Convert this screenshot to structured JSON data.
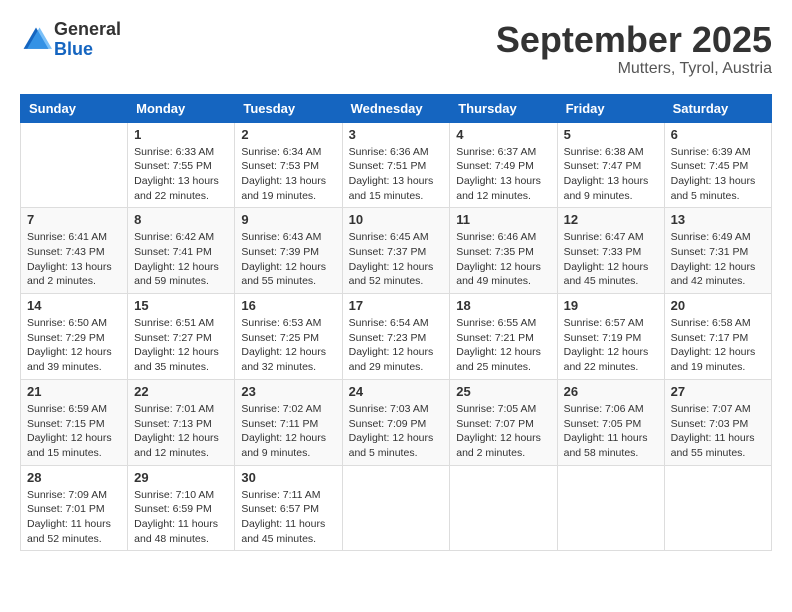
{
  "header": {
    "logo_general": "General",
    "logo_blue": "Blue",
    "month_title": "September 2025",
    "location": "Mutters, Tyrol, Austria"
  },
  "weekdays": [
    "Sunday",
    "Monday",
    "Tuesday",
    "Wednesday",
    "Thursday",
    "Friday",
    "Saturday"
  ],
  "weeks": [
    [
      {
        "day": "",
        "info": ""
      },
      {
        "day": "1",
        "info": "Sunrise: 6:33 AM\nSunset: 7:55 PM\nDaylight: 13 hours and 22 minutes."
      },
      {
        "day": "2",
        "info": "Sunrise: 6:34 AM\nSunset: 7:53 PM\nDaylight: 13 hours and 19 minutes."
      },
      {
        "day": "3",
        "info": "Sunrise: 6:36 AM\nSunset: 7:51 PM\nDaylight: 13 hours and 15 minutes."
      },
      {
        "day": "4",
        "info": "Sunrise: 6:37 AM\nSunset: 7:49 PM\nDaylight: 13 hours and 12 minutes."
      },
      {
        "day": "5",
        "info": "Sunrise: 6:38 AM\nSunset: 7:47 PM\nDaylight: 13 hours and 9 minutes."
      },
      {
        "day": "6",
        "info": "Sunrise: 6:39 AM\nSunset: 7:45 PM\nDaylight: 13 hours and 5 minutes."
      }
    ],
    [
      {
        "day": "7",
        "info": "Sunrise: 6:41 AM\nSunset: 7:43 PM\nDaylight: 13 hours and 2 minutes."
      },
      {
        "day": "8",
        "info": "Sunrise: 6:42 AM\nSunset: 7:41 PM\nDaylight: 12 hours and 59 minutes."
      },
      {
        "day": "9",
        "info": "Sunrise: 6:43 AM\nSunset: 7:39 PM\nDaylight: 12 hours and 55 minutes."
      },
      {
        "day": "10",
        "info": "Sunrise: 6:45 AM\nSunset: 7:37 PM\nDaylight: 12 hours and 52 minutes."
      },
      {
        "day": "11",
        "info": "Sunrise: 6:46 AM\nSunset: 7:35 PM\nDaylight: 12 hours and 49 minutes."
      },
      {
        "day": "12",
        "info": "Sunrise: 6:47 AM\nSunset: 7:33 PM\nDaylight: 12 hours and 45 minutes."
      },
      {
        "day": "13",
        "info": "Sunrise: 6:49 AM\nSunset: 7:31 PM\nDaylight: 12 hours and 42 minutes."
      }
    ],
    [
      {
        "day": "14",
        "info": "Sunrise: 6:50 AM\nSunset: 7:29 PM\nDaylight: 12 hours and 39 minutes."
      },
      {
        "day": "15",
        "info": "Sunrise: 6:51 AM\nSunset: 7:27 PM\nDaylight: 12 hours and 35 minutes."
      },
      {
        "day": "16",
        "info": "Sunrise: 6:53 AM\nSunset: 7:25 PM\nDaylight: 12 hours and 32 minutes."
      },
      {
        "day": "17",
        "info": "Sunrise: 6:54 AM\nSunset: 7:23 PM\nDaylight: 12 hours and 29 minutes."
      },
      {
        "day": "18",
        "info": "Sunrise: 6:55 AM\nSunset: 7:21 PM\nDaylight: 12 hours and 25 minutes."
      },
      {
        "day": "19",
        "info": "Sunrise: 6:57 AM\nSunset: 7:19 PM\nDaylight: 12 hours and 22 minutes."
      },
      {
        "day": "20",
        "info": "Sunrise: 6:58 AM\nSunset: 7:17 PM\nDaylight: 12 hours and 19 minutes."
      }
    ],
    [
      {
        "day": "21",
        "info": "Sunrise: 6:59 AM\nSunset: 7:15 PM\nDaylight: 12 hours and 15 minutes."
      },
      {
        "day": "22",
        "info": "Sunrise: 7:01 AM\nSunset: 7:13 PM\nDaylight: 12 hours and 12 minutes."
      },
      {
        "day": "23",
        "info": "Sunrise: 7:02 AM\nSunset: 7:11 PM\nDaylight: 12 hours and 9 minutes."
      },
      {
        "day": "24",
        "info": "Sunrise: 7:03 AM\nSunset: 7:09 PM\nDaylight: 12 hours and 5 minutes."
      },
      {
        "day": "25",
        "info": "Sunrise: 7:05 AM\nSunset: 7:07 PM\nDaylight: 12 hours and 2 minutes."
      },
      {
        "day": "26",
        "info": "Sunrise: 7:06 AM\nSunset: 7:05 PM\nDaylight: 11 hours and 58 minutes."
      },
      {
        "day": "27",
        "info": "Sunrise: 7:07 AM\nSunset: 7:03 PM\nDaylight: 11 hours and 55 minutes."
      }
    ],
    [
      {
        "day": "28",
        "info": "Sunrise: 7:09 AM\nSunset: 7:01 PM\nDaylight: 11 hours and 52 minutes."
      },
      {
        "day": "29",
        "info": "Sunrise: 7:10 AM\nSunset: 6:59 PM\nDaylight: 11 hours and 48 minutes."
      },
      {
        "day": "30",
        "info": "Sunrise: 7:11 AM\nSunset: 6:57 PM\nDaylight: 11 hours and 45 minutes."
      },
      {
        "day": "",
        "info": ""
      },
      {
        "day": "",
        "info": ""
      },
      {
        "day": "",
        "info": ""
      },
      {
        "day": "",
        "info": ""
      }
    ]
  ]
}
